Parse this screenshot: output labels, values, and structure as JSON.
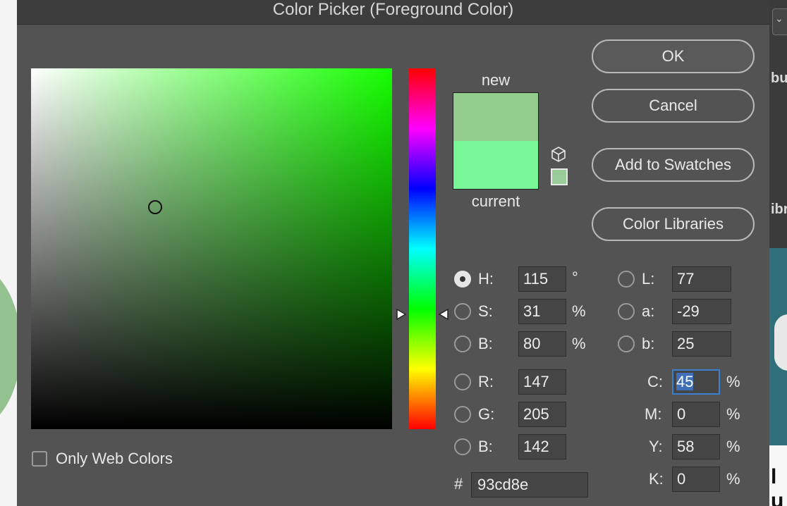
{
  "dialog": {
    "title": "Color Picker (Foreground Color)"
  },
  "buttons": {
    "ok": "OK",
    "cancel": "Cancel",
    "add_to_swatches": "Add to Swatches",
    "color_libraries": "Color Libraries"
  },
  "swatch": {
    "new_label": "new",
    "current_label": "current",
    "new_color": "#93cd8e",
    "current_color": "#77f797"
  },
  "hsb": {
    "h": {
      "label": "H:",
      "value": "115",
      "unit": "°"
    },
    "s": {
      "label": "S:",
      "value": "31",
      "unit": "%"
    },
    "b": {
      "label": "B:",
      "value": "80",
      "unit": "%"
    }
  },
  "rgb": {
    "r": {
      "label": "R:",
      "value": "147"
    },
    "g": {
      "label": "G:",
      "value": "205"
    },
    "b": {
      "label": "B:",
      "value": "142"
    }
  },
  "lab": {
    "l": {
      "label": "L:",
      "value": "77"
    },
    "a": {
      "label": "a:",
      "value": "-29"
    },
    "b": {
      "label": "b:",
      "value": "25"
    }
  },
  "cmyk": {
    "c": {
      "label": "C:",
      "value": "45",
      "unit": "%"
    },
    "m": {
      "label": "M:",
      "value": "0",
      "unit": "%"
    },
    "y": {
      "label": "Y:",
      "value": "58",
      "unit": "%"
    },
    "k": {
      "label": "K:",
      "value": "0",
      "unit": "%"
    }
  },
  "hex": {
    "hash": "#",
    "value": "93cd8e"
  },
  "options": {
    "only_web_colors": "Only Web Colors"
  },
  "icons": {
    "websafe": "cube-icon",
    "hue_marker": "triangle-arrow-icon"
  },
  "background": {
    "right_fragment_1": "bu",
    "right_fragment_2": "ibr",
    "right_fragment_3": "l u"
  }
}
